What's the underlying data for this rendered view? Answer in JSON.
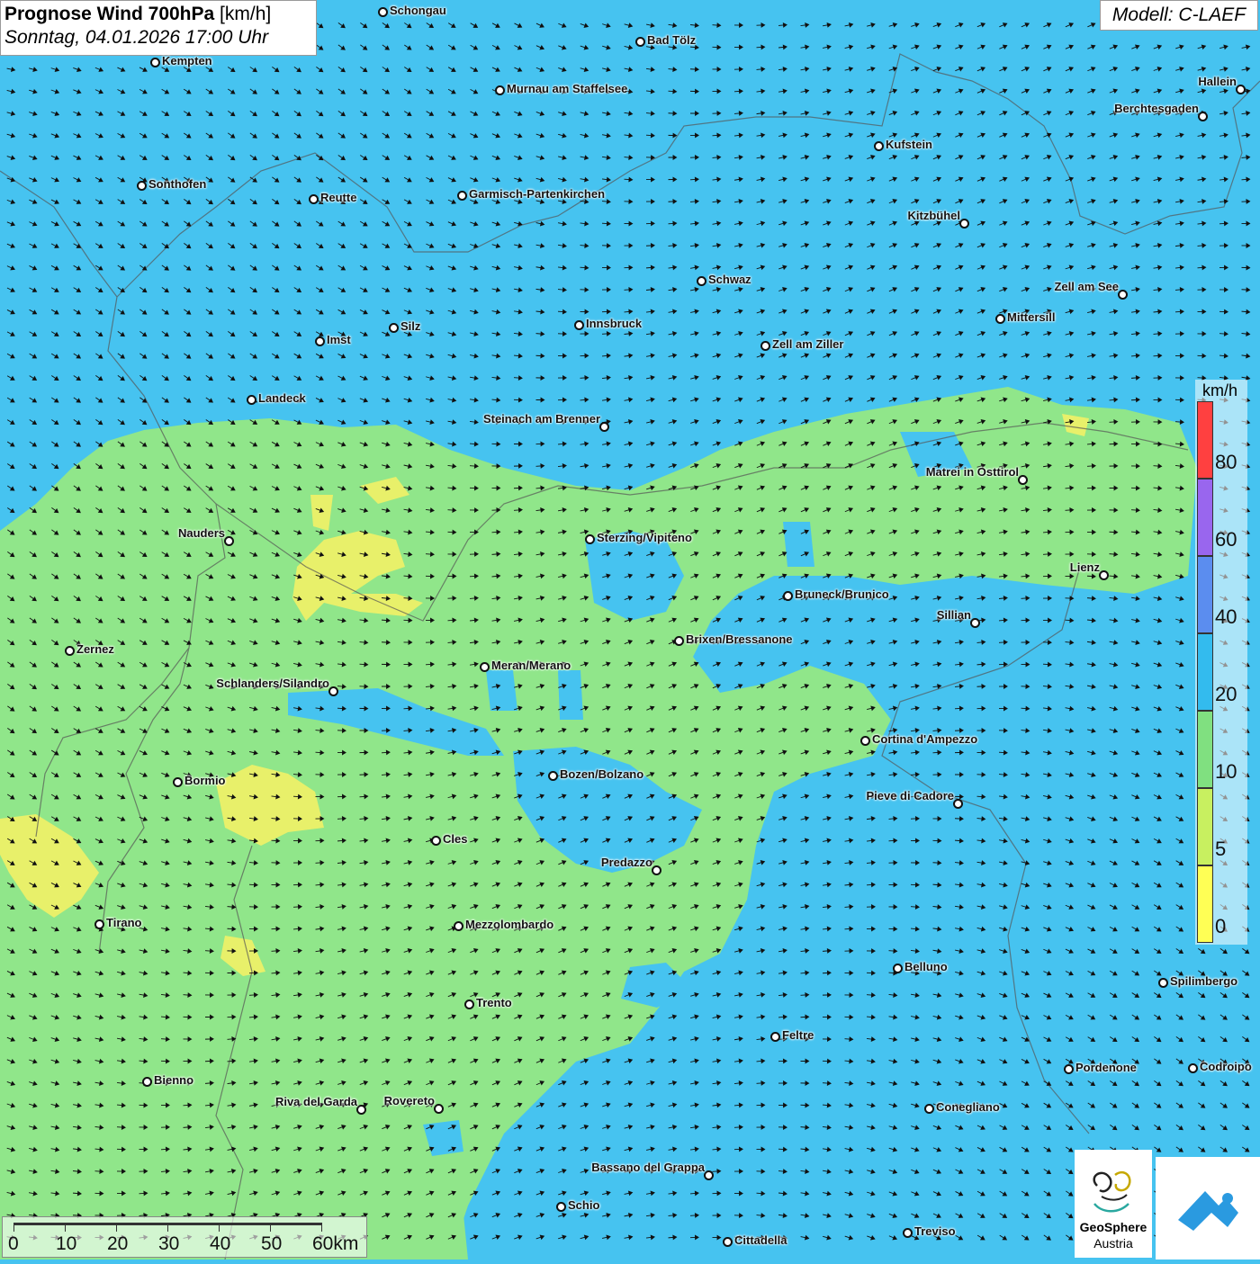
{
  "header": {
    "title_bold": "Prognose Wind 700hPa",
    "title_unit": "[km/h]",
    "datetime": "Sonntag, 04.01.2026 17:00 Uhr",
    "model": "Modell: C-LAEF"
  },
  "legend": {
    "unit": "km/h",
    "ticks": [
      "80",
      "60",
      "40",
      "20",
      "10",
      "5",
      "0"
    ],
    "colors": [
      "#ff4040",
      "#9966ee",
      "#5b8def",
      "#33bbee",
      "#80e080",
      "#c8f060",
      "#ffff55"
    ]
  },
  "scale_bar": {
    "labels": [
      "0",
      "10",
      "20",
      "30",
      "40",
      "50",
      "60km"
    ]
  },
  "branding": {
    "logo_name": "GeoSphere",
    "logo_sub": "Austria"
  },
  "colors": {
    "wind_low": "#46c3f0",
    "wind_mid": "#90e68a",
    "wind_yellow": "#e8f06a"
  },
  "cities": [
    {
      "name": "Schongau",
      "label_side": "right"
    },
    {
      "name": "Bad Tölz",
      "label_side": "right"
    },
    {
      "name": "Kempten",
      "label_side": "right"
    },
    {
      "name": "Murnau am Staffelsee",
      "label_side": "right"
    },
    {
      "name": "Hallein",
      "label_side": "left"
    },
    {
      "name": "Berchtesgaden",
      "label_side": "left"
    },
    {
      "name": "Kufstein",
      "label_side": "right"
    },
    {
      "name": "Sonthofen",
      "label_side": "right"
    },
    {
      "name": "Reutte",
      "label_side": "right"
    },
    {
      "name": "Garmisch-Partenkirchen",
      "label_side": "right"
    },
    {
      "name": "Kitzbühel",
      "label_side": "left"
    },
    {
      "name": "Schwaz",
      "label_side": "right"
    },
    {
      "name": "Zell am See",
      "label_side": "left"
    },
    {
      "name": "Mittersill",
      "label_side": "right"
    },
    {
      "name": "Innsbruck",
      "label_side": "right"
    },
    {
      "name": "Silz",
      "label_side": "right"
    },
    {
      "name": "Imst",
      "label_side": "right"
    },
    {
      "name": "Zell am Ziller",
      "label_side": "right"
    },
    {
      "name": "Landeck",
      "label_side": "right"
    },
    {
      "name": "Steinach am Brenner",
      "label_side": "left"
    },
    {
      "name": "Matrei in Osttirol",
      "label_side": "left"
    },
    {
      "name": "Nauders",
      "label_side": "left"
    },
    {
      "name": "Sterzing/Vipiteno",
      "label_side": "right"
    },
    {
      "name": "Lienz",
      "label_side": "left"
    },
    {
      "name": "Bruneck/Brunico",
      "label_side": "right"
    },
    {
      "name": "Sillian",
      "label_side": "left"
    },
    {
      "name": "Brixen/Bressanone",
      "label_side": "right"
    },
    {
      "name": "Zernez",
      "label_side": "right"
    },
    {
      "name": "Meran/Merano",
      "label_side": "right"
    },
    {
      "name": "Schlanders/Silandro",
      "label_side": "left"
    },
    {
      "name": "Cortina d'Ampezzo",
      "label_side": "right"
    },
    {
      "name": "Bozen/Bolzano",
      "label_side": "right"
    },
    {
      "name": "Bormio",
      "label_side": "right"
    },
    {
      "name": "Pieve di Cadore",
      "label_side": "left"
    },
    {
      "name": "Cles",
      "label_side": "right"
    },
    {
      "name": "Predazzo",
      "label_side": "left"
    },
    {
      "name": "Tirano",
      "label_side": "right"
    },
    {
      "name": "Mezzolombardo",
      "label_side": "right"
    },
    {
      "name": "Belluno",
      "label_side": "right"
    },
    {
      "name": "Spilimbergo",
      "label_side": "right"
    },
    {
      "name": "Trento",
      "label_side": "right"
    },
    {
      "name": "Feltre",
      "label_side": "right"
    },
    {
      "name": "Pordenone",
      "label_side": "right"
    },
    {
      "name": "Codroipo",
      "label_side": "right"
    },
    {
      "name": "Bienno",
      "label_side": "right"
    },
    {
      "name": "Riva del Garda",
      "label_side": "left"
    },
    {
      "name": "Rovereto",
      "label_side": "left"
    },
    {
      "name": "Conegliano",
      "label_side": "right"
    },
    {
      "name": "Bassano del Grappa",
      "label_side": "left"
    },
    {
      "name": "Schio",
      "label_side": "right"
    },
    {
      "name": "Treviso",
      "label_side": "right"
    },
    {
      "name": "Cittadella",
      "label_side": "right"
    }
  ]
}
